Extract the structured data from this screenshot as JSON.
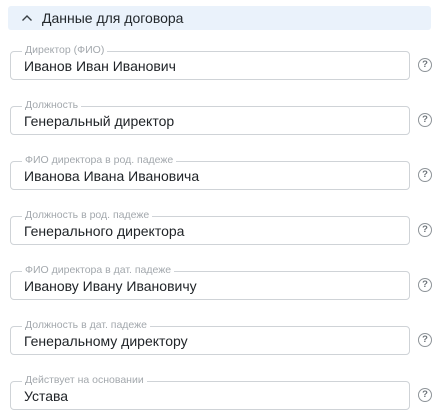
{
  "section": {
    "title": "Данные для договора",
    "icon": "chevron-up-icon"
  },
  "fields": [
    {
      "label": "Директор (ФИО)",
      "value": "Иванов Иван Иванович"
    },
    {
      "label": "Должность",
      "value": "Генеральный директор"
    },
    {
      "label": "ФИО директора в род. падеже",
      "value": "Иванова Ивана Ивановича"
    },
    {
      "label": "Должность в род. падеже",
      "value": "Генерального директора"
    },
    {
      "label": "ФИО директора в дат. падеже",
      "value": "Иванову Ивану Ивановичу"
    },
    {
      "label": "Должность в дат. падеже",
      "value": "Генеральному директору"
    },
    {
      "label": "Действует на основании",
      "value": "Устава"
    }
  ],
  "help_glyph": "?"
}
